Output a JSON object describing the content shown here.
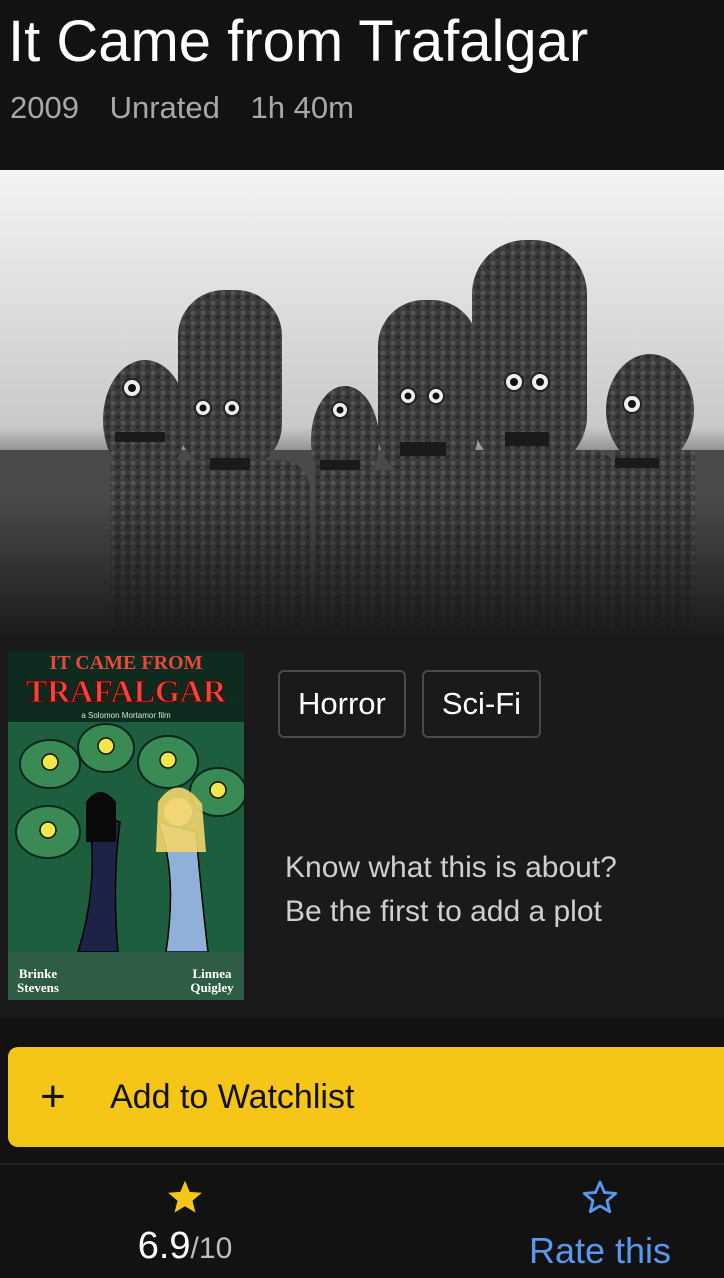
{
  "title": {
    "text": "It Came from Trafalgar",
    "year": "2009",
    "certificate": "Unrated",
    "runtime": "1h 40m"
  },
  "hero": {
    "icon": "still-image"
  },
  "poster": {
    "line1": "IT CAME FROM",
    "line2": "TRAFALGAR",
    "tagline": "a Solomon Mortamor film",
    "credit_left_1": "Brinke",
    "credit_left_2": "Stevens",
    "credit_right_1": "Linnea",
    "credit_right_2": "Quigley"
  },
  "genres": [
    "Horror",
    "Sci-Fi"
  ],
  "plot": {
    "line1": "Know what this is about?",
    "line2": "Be the first to add a plot"
  },
  "watchlist": {
    "icon": "plus-icon",
    "label": "Add to Watchlist"
  },
  "rating": {
    "value": "6.9",
    "scale": "/10",
    "star_color": "#f5c518",
    "rate_label": "Rate this",
    "rate_color": "#5799ef"
  },
  "colors": {
    "background": "#121212",
    "accent": "#f5c518",
    "link": "#5799ef"
  }
}
